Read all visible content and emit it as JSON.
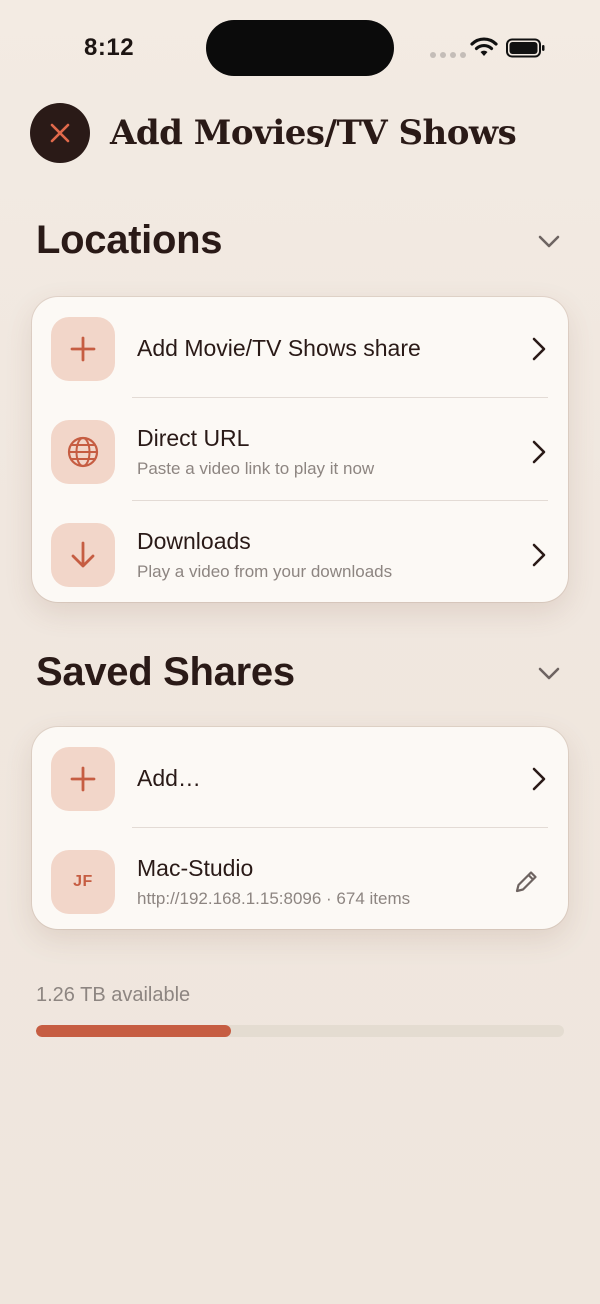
{
  "status_bar": {
    "time": "8:12"
  },
  "header": {
    "title": "Add Movies/TV Shows"
  },
  "locations": {
    "heading": "Locations",
    "items": [
      {
        "title": "Add Movie/TV Shows share",
        "subtitle": "",
        "icon": "plus-icon"
      },
      {
        "title": "Direct URL",
        "subtitle": "Paste a video link to play it now",
        "icon": "globe-icon"
      },
      {
        "title": "Downloads",
        "subtitle": "Play a video from your downloads",
        "icon": "arrow-down-icon"
      }
    ]
  },
  "saved_shares": {
    "heading": "Saved Shares",
    "items": [
      {
        "title": "Add…",
        "icon": "plus-icon"
      },
      {
        "title": "Mac-Studio",
        "subtitle": "http://192.168.1.15:8096 · 674 items",
        "initials": "JF",
        "icon": "pencil-icon"
      }
    ]
  },
  "storage": {
    "label": "1.26 TB available",
    "used_fraction": 0.37
  },
  "colors": {
    "accent": "#c65d42",
    "tile": "#f2d6c9",
    "text": "#2a1a17",
    "muted": "#8d8581"
  }
}
